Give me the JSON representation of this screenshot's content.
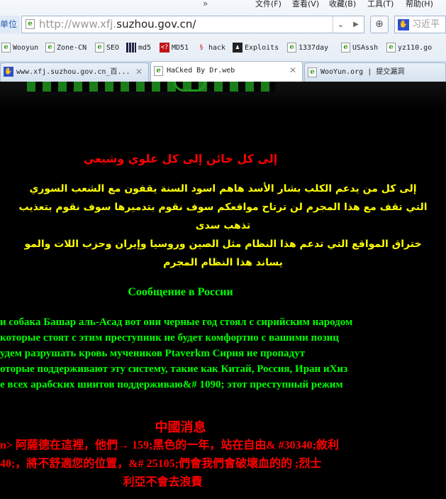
{
  "menu": {
    "items": [
      "文件(F)",
      "查看(V)",
      "收藏(B)",
      "工具(T)",
      "帮助(H)"
    ]
  },
  "address": {
    "location_label": "单位",
    "url_prefix": "http://www.xfj.",
    "url_domain": "suzhou.gov.cn/",
    "search_placeholder": "习近平"
  },
  "favorites": [
    {
      "label": "Wooyun",
      "icon": "ie-page-icon"
    },
    {
      "label": "Zone-CN",
      "icon": "ie-page-icon"
    },
    {
      "label": "SEO",
      "icon": "ie-page-icon"
    },
    {
      "label": "md5",
      "icon": "grid-icon"
    },
    {
      "label": "MD51",
      "icon": "red-badge-icon"
    },
    {
      "label": "hack",
      "icon": "dragon-icon"
    },
    {
      "label": "Exploits",
      "icon": "figure-icon"
    },
    {
      "label": "1337day",
      "icon": "ie-page-icon"
    },
    {
      "label": "USAssh",
      "icon": "ie-page-icon"
    },
    {
      "label": "yz110.go",
      "icon": "ie-page-icon"
    }
  ],
  "tabs": [
    {
      "label": "www.xfj.suzhou.gov.cn_百...",
      "active": false
    },
    {
      "label": "HaCked By Dr.web",
      "active": true
    },
    {
      "label": "WooYun.org | 提交漏洞",
      "active": false
    }
  ],
  "page": {
    "arabic_heading": "إلى كل خائن إلى كل علوي وشيعي",
    "arabic_lines": [
      "إلى كل من يدعم الكلب بشار الأسد هاهم اسود السنة يقفون مع الشعب السوري",
      "التي تقف مع هذا المجرم لن ترتاح مواقعكم سوف نقوم بتدميرها سوف نقوم بتعذيب",
      "تذهب سدى",
      "ختراق المواقع التي تدعم هذا النظام مثل الصين وروسيا وإيران وحزب اللات والمو",
      "يساند هذا النظام المجرم"
    ],
    "russian_heading": "Сообщение в России",
    "russian_lines": [
      "и собака Башар аль-Асад вот они черные год  стоял с сирийским народом",
      "которые стоят  с этим  преступник не будет комфортно с вашими позиц",
      "удем разрушать  кровь мучеников Ptaverkm Сирия  не пропадут",
      "оторые поддерживают  эту систему, такие как Китай, Россия, Иран иХиз",
      "е  всех арабских шиитов поддерживаю&# 1090; этот  преступный режим"
    ],
    "chinese_heading": "中國消息",
    "chinese_lines": [
      "n> 阿薩德在這裡，他們→ 159;黑色的一年，站在自由& #30340;敘利",
      "40;，將不舒適您的位置，&# 25105;們會我們會破壞血的的 ;烈士",
      "利亞不會去浪費"
    ]
  },
  "colors": {
    "background": "#000000",
    "arabic_heading": "#ff0000",
    "arabic": "#ffff00",
    "russian": "#00ff00",
    "chinese": "#ff0000"
  }
}
